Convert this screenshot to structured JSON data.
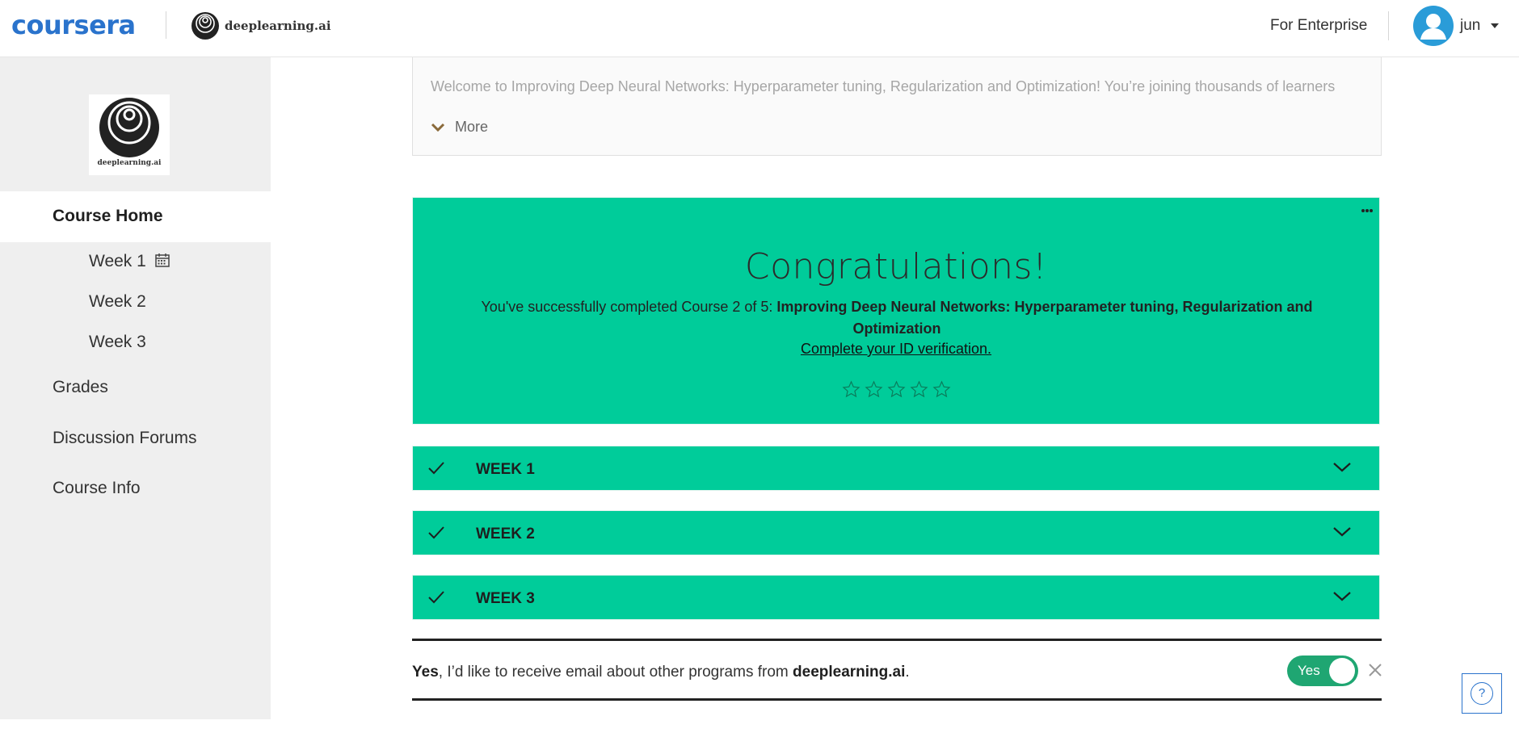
{
  "header": {
    "logo": "coursera",
    "partner": "deeplearning.ai",
    "enterprise": "For Enterprise",
    "username": "jun"
  },
  "sidebar": {
    "logo_text": "deeplearning.ai",
    "home": "Course Home",
    "weeks": [
      "Week 1",
      "Week 2",
      "Week 3"
    ],
    "items": [
      "Grades",
      "Discussion Forums",
      "Course Info"
    ]
  },
  "description": {
    "text": "Welcome to Improving Deep Neural Networks: Hyperparameter tuning, Regularization and Optimization! You’re joining thousands of learners",
    "more": "More"
  },
  "congrats": {
    "title": "Congratulations!",
    "line_prefix": "You've successfully completed Course 2 of 5: ",
    "course_name": "Improving Deep Neural Networks: Hyperparameter tuning, Regularization and Optimization",
    "id_link": "Complete your ID verification.",
    "rating": 0,
    "stars_total": 5
  },
  "weeks": [
    "WEEK 1",
    "WEEK 2",
    "WEEK 3"
  ],
  "email": {
    "yes": "Yes",
    "middle": ", I’d like to receive email about other programs from ",
    "org": "deeplearning.ai",
    "end": ".",
    "toggle_label": "Yes"
  },
  "help": "?",
  "colors": {
    "accent_green": "#00cc9a",
    "toggle_green": "#1fa672",
    "coursera_blue": "#2a73cc"
  }
}
